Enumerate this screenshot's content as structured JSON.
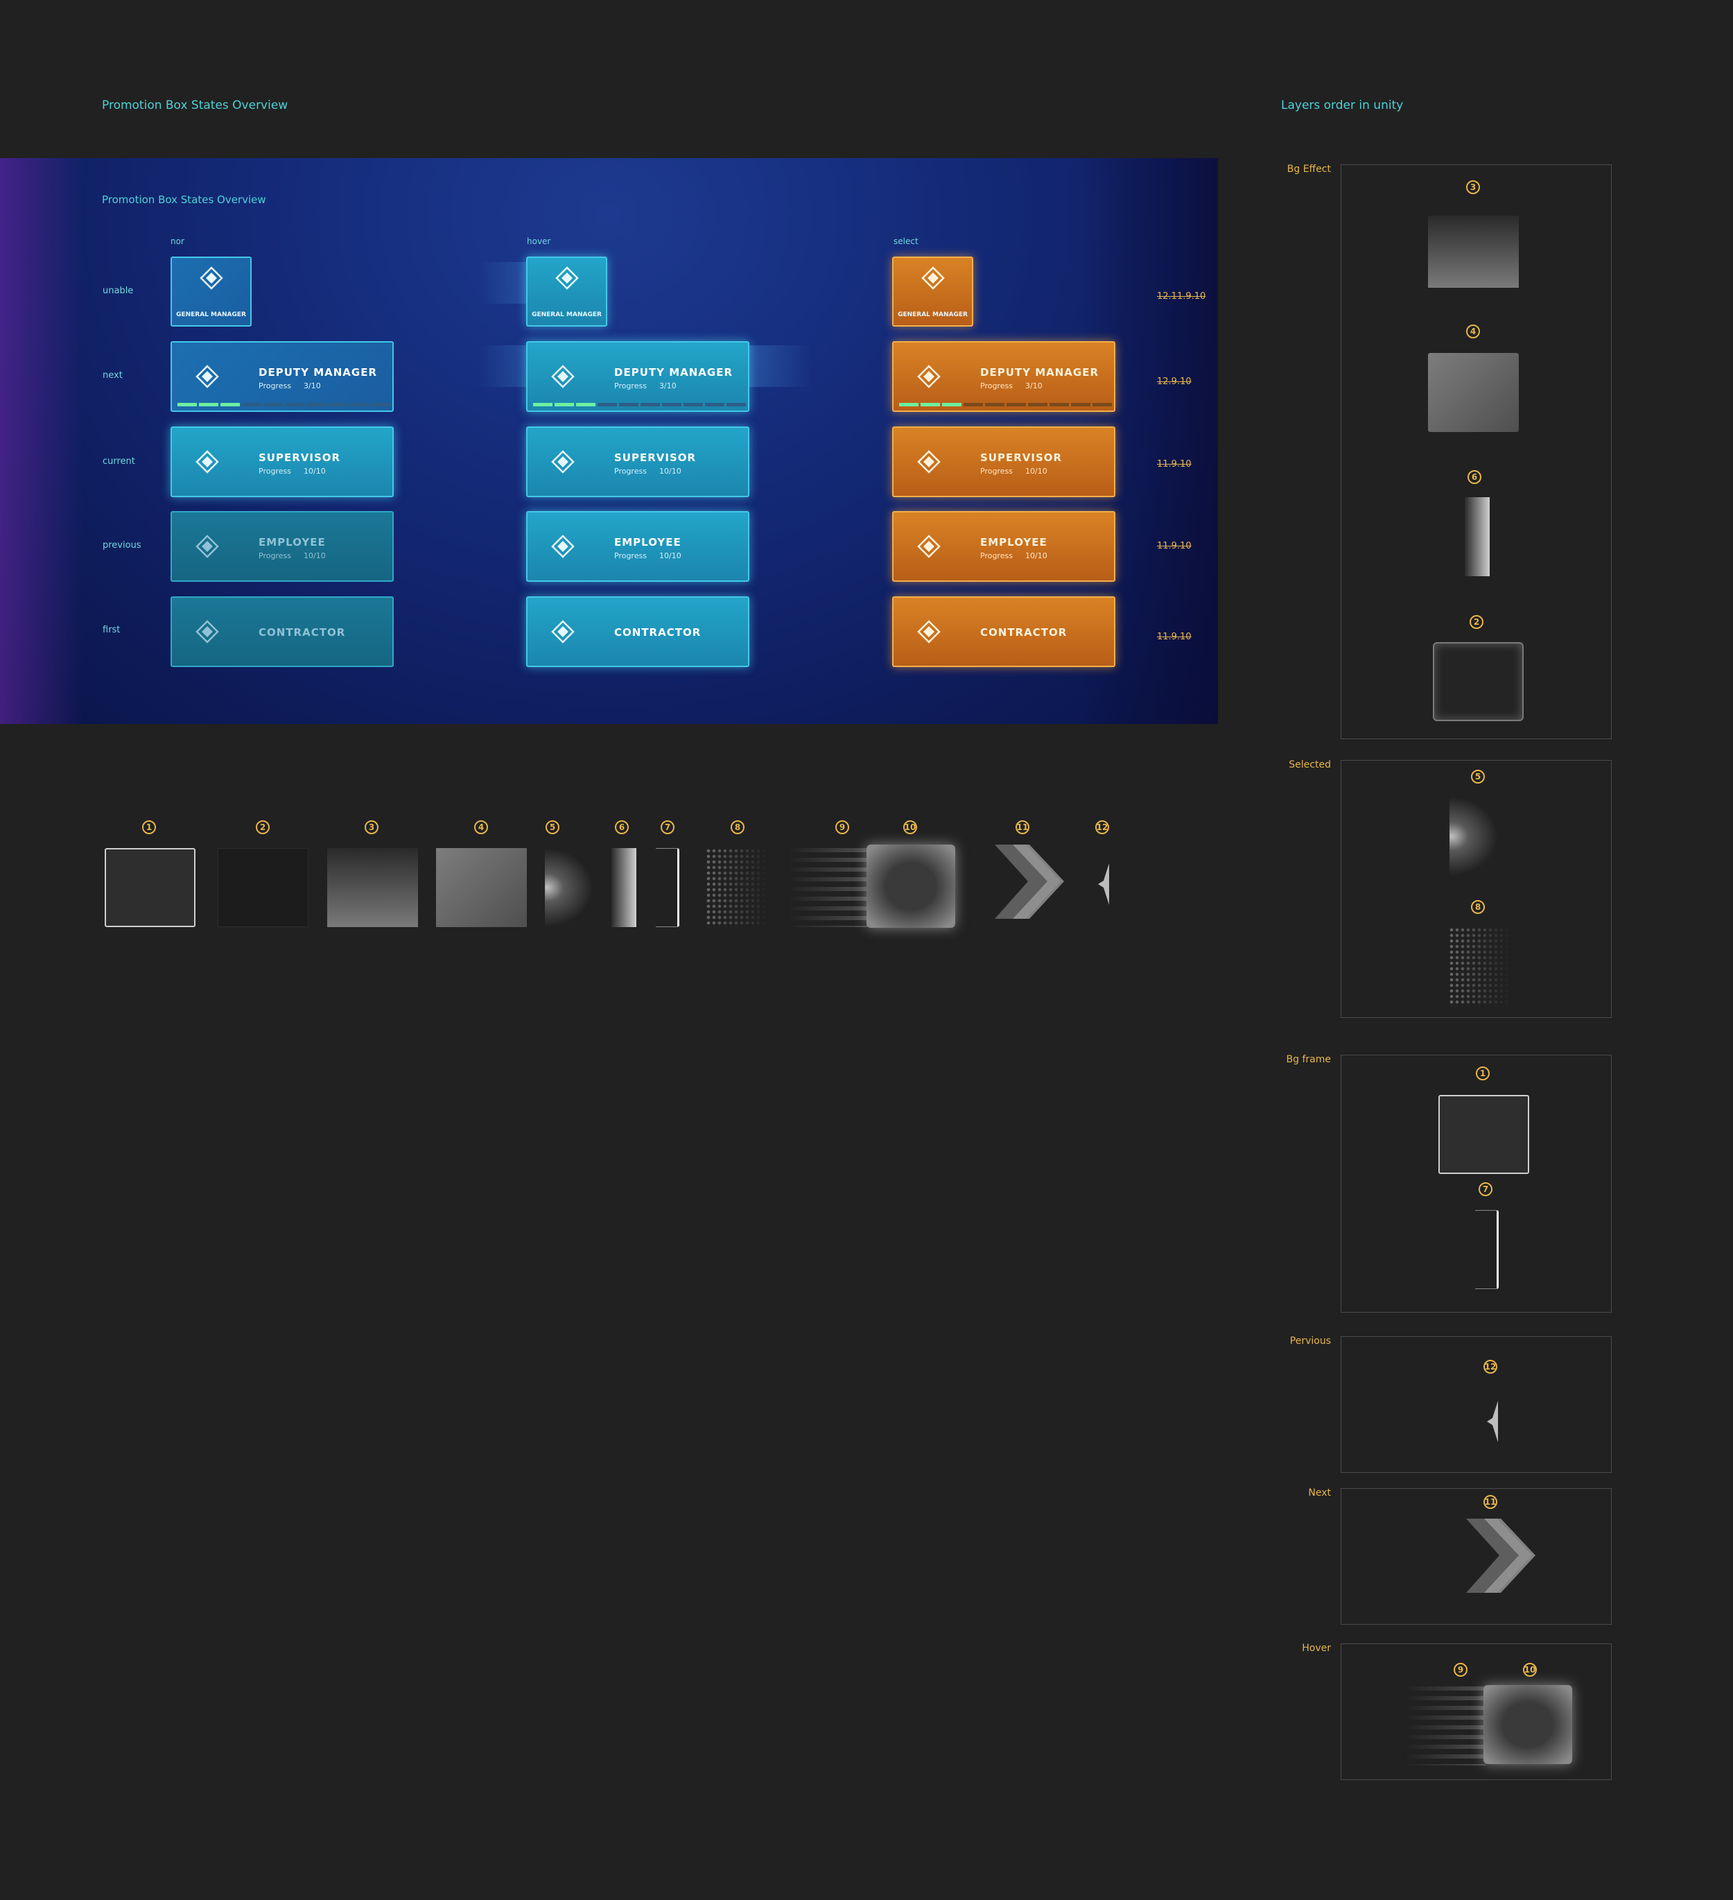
{
  "header": {
    "left_title": "Promotion Box States Overview",
    "right_title": "Layers order in unity"
  },
  "overview": {
    "title": "Promotion Box States Overview",
    "columns": [
      "nor",
      "hover",
      "select"
    ],
    "rows": [
      "unable",
      "next",
      "current",
      "previous",
      "first"
    ],
    "dates": [
      "12.11.9.10",
      "12.9.10",
      "11.9.10",
      "11.9.10",
      "11.9.10"
    ],
    "cards": {
      "general_manager": "GENERAL MANAGER",
      "deputy_manager": "DEPUTY MANAGER",
      "supervisor": "SUPERVISOR",
      "employee": "EMPLOYEE",
      "contractor": "CONTRACTOR",
      "progress_label": "Progress",
      "progress_next": "3/10",
      "progress_full": "10/10",
      "progress_next_fraction": 0.3
    }
  },
  "swatches": {
    "numbers": [
      "1",
      "2",
      "3",
      "4",
      "5",
      "6",
      "7",
      "8",
      "9",
      "10",
      "11",
      "12"
    ]
  },
  "layers": {
    "sections": [
      {
        "label": "Bg Effect",
        "numbers": [
          "3",
          "4",
          "6",
          "2"
        ]
      },
      {
        "label": "Selected",
        "numbers": [
          "5",
          "8"
        ]
      },
      {
        "label": "Bg frame",
        "numbers": [
          "1",
          "7"
        ]
      },
      {
        "label": "Pervious",
        "numbers": [
          "12"
        ]
      },
      {
        "label": "Next",
        "numbers": [
          "11"
        ]
      },
      {
        "label": "Hover",
        "numbers": [
          "9",
          "10"
        ]
      }
    ]
  },
  "colors": {
    "background": "#212121",
    "teal": "#4fd1d8",
    "gold": "#e8b64a",
    "orange_card": "#d98224",
    "cyan_card": "#23a5c9",
    "progress_green": "#6cf0a0"
  }
}
